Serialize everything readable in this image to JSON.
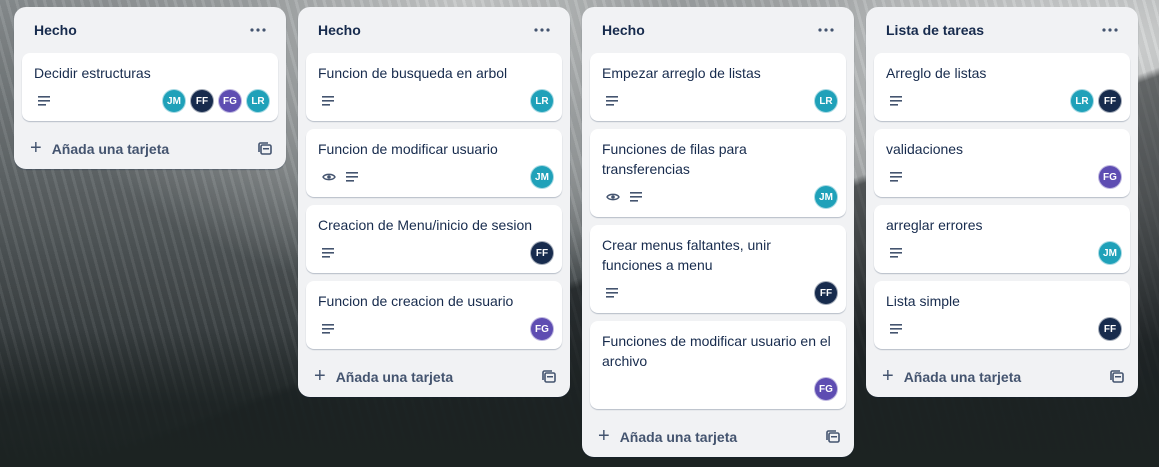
{
  "colors": {
    "avatar_jm": "#1fa1b9",
    "avatar_ff": "#172b4d",
    "avatar_fg": "#5e4db2",
    "avatar_lr": "#1fa1b9"
  },
  "lists": [
    {
      "title": "Hecho",
      "add_label": "Añada una tarjeta",
      "cards": [
        {
          "title": "Decidir estructuras",
          "members": [
            "JM",
            "FF",
            "FG",
            "LR"
          ]
        }
      ]
    },
    {
      "title": "Hecho",
      "add_label": "Añada una tarjeta",
      "cards": [
        {
          "title": "Funcion de busqueda en arbol",
          "members": [
            "LR"
          ]
        },
        {
          "title": "Funcion de modificar usuario",
          "members": [
            "JM"
          ]
        },
        {
          "title": "Creacion de Menu/inicio de sesion",
          "members": [
            "FF"
          ]
        },
        {
          "title": "Funcion de creacion de usuario",
          "members": [
            "FG"
          ]
        }
      ]
    },
    {
      "title": "Hecho",
      "add_label": "Añada una tarjeta",
      "cards": [
        {
          "title": "Empezar arreglo de listas",
          "members": [
            "LR"
          ]
        },
        {
          "title": "Funciones de filas para transferencias",
          "members": [
            "JM"
          ]
        },
        {
          "title": "Crear menus faltantes, unir funciones a menu",
          "members": [
            "FF"
          ]
        },
        {
          "title": "Funciones de modificar usuario en el archivo",
          "members": [
            "FG"
          ]
        }
      ]
    },
    {
      "title": "Lista de tareas",
      "add_label": "Añada una tarjeta",
      "cards": [
        {
          "title": "Arreglo de listas",
          "members": [
            "LR",
            "FF"
          ]
        },
        {
          "title": "validaciones",
          "members": [
            "FG"
          ]
        },
        {
          "title": "arreglar errores",
          "members": [
            "JM"
          ]
        },
        {
          "title": "Lista simple",
          "members": [
            "FF"
          ]
        }
      ]
    }
  ]
}
